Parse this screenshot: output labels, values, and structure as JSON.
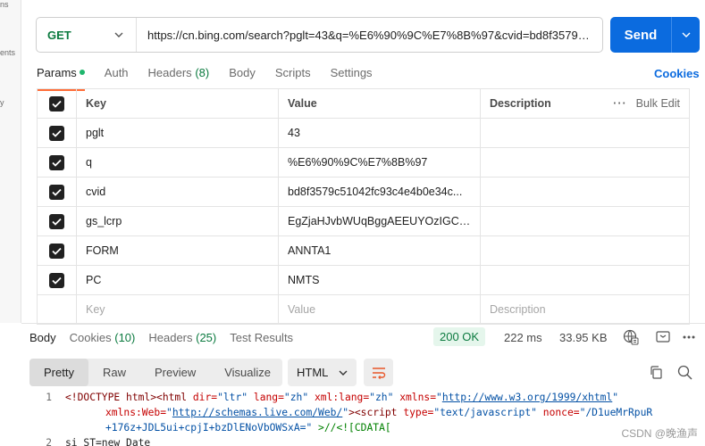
{
  "sidebar_fragments": [
    "ns",
    "ents",
    "y"
  ],
  "request": {
    "method": "GET",
    "url": "https://cn.bing.com/search?pglt=43&q=%E6%90%9C%E7%8B%97&cvid=bd8f3579c51…",
    "send_label": "Send"
  },
  "request_tabs": [
    {
      "label": "Params"
    },
    {
      "label": "Auth"
    },
    {
      "label": "Headers",
      "count": "(8)"
    },
    {
      "label": "Body"
    },
    {
      "label": "Scripts"
    },
    {
      "label": "Settings"
    }
  ],
  "cookies_label": "Cookies",
  "params": {
    "headers": {
      "key": "Key",
      "value": "Value",
      "description": "Description",
      "bulk_edit": "Bulk Edit"
    },
    "rows": [
      {
        "key": "pglt",
        "value": "43"
      },
      {
        "key": "q",
        "value": "%E6%90%9C%E7%8B%97"
      },
      {
        "key": "cvid",
        "value": "bd8f3579c51042fc93c4e4b0e34c..."
      },
      {
        "key": "gs_lcrp",
        "value": "EgZjaHJvbWUqBggAEEUYOzIGCAA..."
      },
      {
        "key": "FORM",
        "value": "ANNTA1"
      },
      {
        "key": "PC",
        "value": "NMTS"
      }
    ],
    "placeholders": {
      "key": "Key",
      "value": "Value",
      "description": "Description"
    }
  },
  "response": {
    "tabs": [
      {
        "label": "Body"
      },
      {
        "label": "Cookies",
        "count": "(10)"
      },
      {
        "label": "Headers",
        "count": "(25)"
      },
      {
        "label": "Test Results"
      }
    ],
    "status": "200 OK",
    "time": "222 ms",
    "size": "33.95 KB",
    "view_modes": [
      "Pretty",
      "Raw",
      "Preview",
      "Visualize"
    ],
    "format": "HTML",
    "code": {
      "line1": "1",
      "line2": "2",
      "doctype": "<!DOCTYPE html>",
      "html_open": "<html",
      "attr_dir": "dir=",
      "val_dir": "\"ltr\"",
      "attr_lang": "lang=",
      "val_lang": "\"zh\"",
      "attr_xmllang": "xml:lang=",
      "val_xmllang": "\"zh\"",
      "attr_xmlns": "xmlns=",
      "val_xmlns": "http://www.w3.org/1999/xhtml",
      "attr_xmlnsweb": "xmlns:Web=",
      "val_xmlnsweb": "http://schemas.live.com/Web/",
      "script_open": "><script",
      "attr_type": "type=",
      "val_type": "\"text/javascript\"",
      "attr_nonce": "nonce=",
      "val_nonce": "\"/D1ueMrRpuR",
      "val_nonce2": "+176z+JDL5ui+cpjI+bzDlENoVbOWSxA=\"",
      "tail": " >//<![CDATA[",
      "line2_text": "si_ST=new Date"
    }
  },
  "watermark": "CSDN @晚渔声",
  "colors": {
    "accent": "#ff6c37",
    "send": "#0b6bdf",
    "method": "#0b7a3f",
    "status_bg": "#e5f6ec"
  }
}
